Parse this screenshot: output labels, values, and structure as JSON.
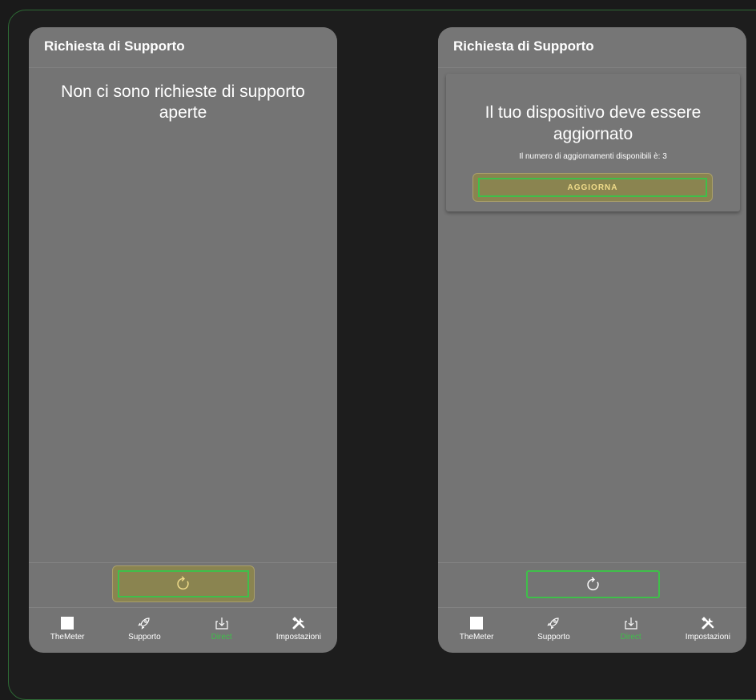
{
  "colors": {
    "background": "#1a1a1a",
    "screen": "#747474",
    "accent_green": "#3fbf4a",
    "button_fill": "#8a8450",
    "button_text": "#f0dc8a"
  },
  "left_screen": {
    "appbar_title": "Richiesta di Supporto",
    "empty_message": "Non ci sono richieste di supporto aperte",
    "refresh_button_icon": "refresh-icon"
  },
  "right_screen": {
    "appbar_title": "Richiesta di Supporto",
    "card_title": "Il tuo dispositivo deve essere aggiornato",
    "card_subtitle": "Il numero di aggiornamenti disponibili è: 3",
    "update_button_label": "AGGIORNA",
    "refresh_button_icon": "refresh-icon"
  },
  "navbar": {
    "items": [
      {
        "label": "TheMeter",
        "icon": "square-icon",
        "active": false
      },
      {
        "label": "Supporto",
        "icon": "rocket-icon",
        "active": false
      },
      {
        "label": "Direct",
        "icon": "download-icon",
        "active": true
      },
      {
        "label": "Impostazioni",
        "icon": "tools-icon",
        "active": false
      }
    ]
  }
}
